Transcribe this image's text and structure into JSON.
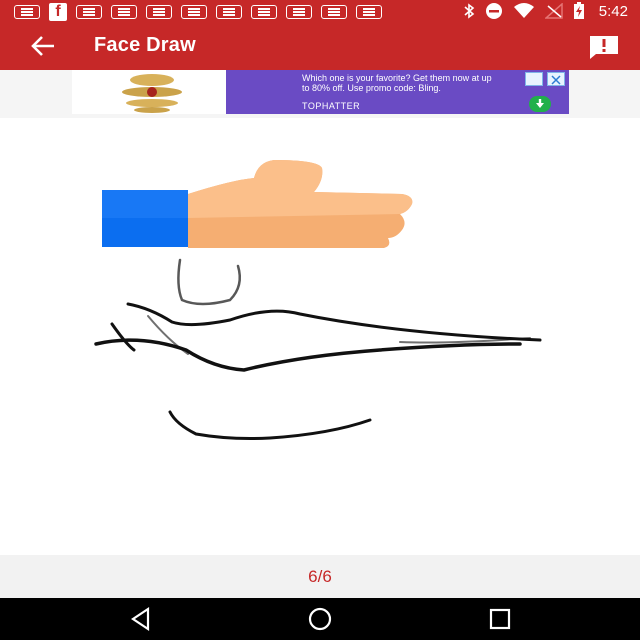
{
  "status_bar": {
    "time": "5:42",
    "icons": [
      "notification-icon",
      "facebook-icon",
      "message-icon",
      "bluetooth-icon",
      "do-not-disturb-icon",
      "wifi-icon",
      "signal-icon",
      "battery-charging-icon"
    ],
    "color": "#c62828"
  },
  "toolbar": {
    "title": "Face Draw",
    "back_icon": "back-arrow-icon",
    "feedback_icon": "feedback-icon"
  },
  "ad": {
    "text": "Which one is your favorite? Get them now at up to 80% off. Use promo code: Bling.",
    "brand": "TOPHATTER",
    "accent": "#6a4bc4"
  },
  "drawing": {
    "overlay_icon": "thumbs-up-icon"
  },
  "pager": {
    "indicator": "6/6"
  },
  "nav_bar": {
    "buttons": [
      "back-triangle-icon",
      "home-circle-icon",
      "recents-square-icon"
    ]
  }
}
